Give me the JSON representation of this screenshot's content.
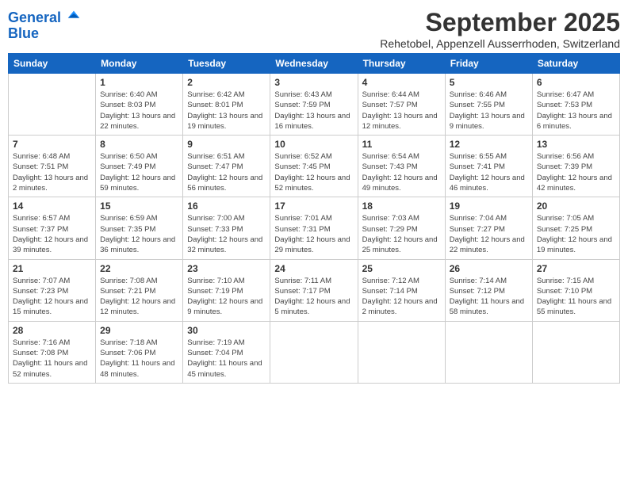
{
  "logo": {
    "line1": "General",
    "line2": "Blue"
  },
  "title": "September 2025",
  "subtitle": "Rehetobel, Appenzell Ausserrhoden, Switzerland",
  "days_of_week": [
    "Sunday",
    "Monday",
    "Tuesday",
    "Wednesday",
    "Thursday",
    "Friday",
    "Saturday"
  ],
  "weeks": [
    [
      {
        "day": "",
        "info": ""
      },
      {
        "day": "1",
        "info": "Sunrise: 6:40 AM\nSunset: 8:03 PM\nDaylight: 13 hours and 22 minutes."
      },
      {
        "day": "2",
        "info": "Sunrise: 6:42 AM\nSunset: 8:01 PM\nDaylight: 13 hours and 19 minutes."
      },
      {
        "day": "3",
        "info": "Sunrise: 6:43 AM\nSunset: 7:59 PM\nDaylight: 13 hours and 16 minutes."
      },
      {
        "day": "4",
        "info": "Sunrise: 6:44 AM\nSunset: 7:57 PM\nDaylight: 13 hours and 12 minutes."
      },
      {
        "day": "5",
        "info": "Sunrise: 6:46 AM\nSunset: 7:55 PM\nDaylight: 13 hours and 9 minutes."
      },
      {
        "day": "6",
        "info": "Sunrise: 6:47 AM\nSunset: 7:53 PM\nDaylight: 13 hours and 6 minutes."
      }
    ],
    [
      {
        "day": "7",
        "info": "Sunrise: 6:48 AM\nSunset: 7:51 PM\nDaylight: 13 hours and 2 minutes."
      },
      {
        "day": "8",
        "info": "Sunrise: 6:50 AM\nSunset: 7:49 PM\nDaylight: 12 hours and 59 minutes."
      },
      {
        "day": "9",
        "info": "Sunrise: 6:51 AM\nSunset: 7:47 PM\nDaylight: 12 hours and 56 minutes."
      },
      {
        "day": "10",
        "info": "Sunrise: 6:52 AM\nSunset: 7:45 PM\nDaylight: 12 hours and 52 minutes."
      },
      {
        "day": "11",
        "info": "Sunrise: 6:54 AM\nSunset: 7:43 PM\nDaylight: 12 hours and 49 minutes."
      },
      {
        "day": "12",
        "info": "Sunrise: 6:55 AM\nSunset: 7:41 PM\nDaylight: 12 hours and 46 minutes."
      },
      {
        "day": "13",
        "info": "Sunrise: 6:56 AM\nSunset: 7:39 PM\nDaylight: 12 hours and 42 minutes."
      }
    ],
    [
      {
        "day": "14",
        "info": "Sunrise: 6:57 AM\nSunset: 7:37 PM\nDaylight: 12 hours and 39 minutes."
      },
      {
        "day": "15",
        "info": "Sunrise: 6:59 AM\nSunset: 7:35 PM\nDaylight: 12 hours and 36 minutes."
      },
      {
        "day": "16",
        "info": "Sunrise: 7:00 AM\nSunset: 7:33 PM\nDaylight: 12 hours and 32 minutes."
      },
      {
        "day": "17",
        "info": "Sunrise: 7:01 AM\nSunset: 7:31 PM\nDaylight: 12 hours and 29 minutes."
      },
      {
        "day": "18",
        "info": "Sunrise: 7:03 AM\nSunset: 7:29 PM\nDaylight: 12 hours and 25 minutes."
      },
      {
        "day": "19",
        "info": "Sunrise: 7:04 AM\nSunset: 7:27 PM\nDaylight: 12 hours and 22 minutes."
      },
      {
        "day": "20",
        "info": "Sunrise: 7:05 AM\nSunset: 7:25 PM\nDaylight: 12 hours and 19 minutes."
      }
    ],
    [
      {
        "day": "21",
        "info": "Sunrise: 7:07 AM\nSunset: 7:23 PM\nDaylight: 12 hours and 15 minutes."
      },
      {
        "day": "22",
        "info": "Sunrise: 7:08 AM\nSunset: 7:21 PM\nDaylight: 12 hours and 12 minutes."
      },
      {
        "day": "23",
        "info": "Sunrise: 7:10 AM\nSunset: 7:19 PM\nDaylight: 12 hours and 9 minutes."
      },
      {
        "day": "24",
        "info": "Sunrise: 7:11 AM\nSunset: 7:17 PM\nDaylight: 12 hours and 5 minutes."
      },
      {
        "day": "25",
        "info": "Sunrise: 7:12 AM\nSunset: 7:14 PM\nDaylight: 12 hours and 2 minutes."
      },
      {
        "day": "26",
        "info": "Sunrise: 7:14 AM\nSunset: 7:12 PM\nDaylight: 11 hours and 58 minutes."
      },
      {
        "day": "27",
        "info": "Sunrise: 7:15 AM\nSunset: 7:10 PM\nDaylight: 11 hours and 55 minutes."
      }
    ],
    [
      {
        "day": "28",
        "info": "Sunrise: 7:16 AM\nSunset: 7:08 PM\nDaylight: 11 hours and 52 minutes."
      },
      {
        "day": "29",
        "info": "Sunrise: 7:18 AM\nSunset: 7:06 PM\nDaylight: 11 hours and 48 minutes."
      },
      {
        "day": "30",
        "info": "Sunrise: 7:19 AM\nSunset: 7:04 PM\nDaylight: 11 hours and 45 minutes."
      },
      {
        "day": "",
        "info": ""
      },
      {
        "day": "",
        "info": ""
      },
      {
        "day": "",
        "info": ""
      },
      {
        "day": "",
        "info": ""
      }
    ]
  ]
}
